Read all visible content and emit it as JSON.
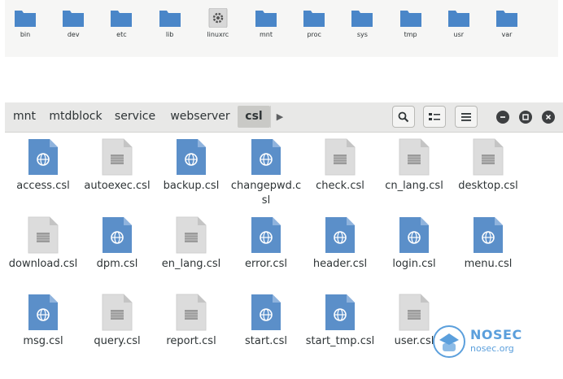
{
  "top_folders": [
    {
      "label": "bin",
      "icon": "folder-icon"
    },
    {
      "label": "dev",
      "icon": "folder-icon"
    },
    {
      "label": "etc",
      "icon": "folder-icon"
    },
    {
      "label": "lib",
      "icon": "folder-icon"
    },
    {
      "label": "linuxrc",
      "icon": "executable-gear-icon"
    },
    {
      "label": "mnt",
      "icon": "folder-icon"
    },
    {
      "label": "proc",
      "icon": "folder-icon"
    },
    {
      "label": "sys",
      "icon": "folder-icon"
    },
    {
      "label": "tmp",
      "icon": "folder-icon"
    },
    {
      "label": "usr",
      "icon": "folder-icon"
    },
    {
      "label": "var",
      "icon": "folder-icon"
    }
  ],
  "breadcrumbs": [
    "mnt",
    "mtdblock",
    "service",
    "webserver",
    "csl"
  ],
  "files": [
    {
      "label": "access.csl",
      "icon": "web-file-icon"
    },
    {
      "label": "autoexec.csl",
      "icon": "text-file-icon"
    },
    {
      "label": "backup.csl",
      "icon": "web-file-icon"
    },
    {
      "label": "changepwd.csl",
      "icon": "web-file-icon"
    },
    {
      "label": "check.csl",
      "icon": "text-file-icon"
    },
    {
      "label": "cn_lang.csl",
      "icon": "text-file-icon"
    },
    {
      "label": "desktop.csl",
      "icon": "text-file-icon"
    },
    {
      "label": "download.csl",
      "icon": "text-file-icon"
    },
    {
      "label": "dpm.csl",
      "icon": "web-file-icon"
    },
    {
      "label": "en_lang.csl",
      "icon": "text-file-icon"
    },
    {
      "label": "error.csl",
      "icon": "web-file-icon"
    },
    {
      "label": "header.csl",
      "icon": "web-file-icon"
    },
    {
      "label": "login.csl",
      "icon": "web-file-icon"
    },
    {
      "label": "menu.csl",
      "icon": "web-file-icon"
    },
    {
      "label": "msg.csl",
      "icon": "web-file-icon"
    },
    {
      "label": "query.csl",
      "icon": "text-file-icon"
    },
    {
      "label": "report.csl",
      "icon": "text-file-icon"
    },
    {
      "label": "start.csl",
      "icon": "web-file-icon"
    },
    {
      "label": "start_tmp.csl",
      "icon": "web-file-icon"
    },
    {
      "label": "user.csl",
      "icon": "text-file-icon"
    }
  ],
  "watermark": {
    "name": "NOSEC",
    "url": "nosec.org"
  },
  "colors": {
    "folder": "#4a86c8",
    "web_file": "#5b8fc9",
    "text_file": "#dcdcdc",
    "headerbar": "#e8e8e7",
    "active_crumb": "#c9c9c6"
  }
}
